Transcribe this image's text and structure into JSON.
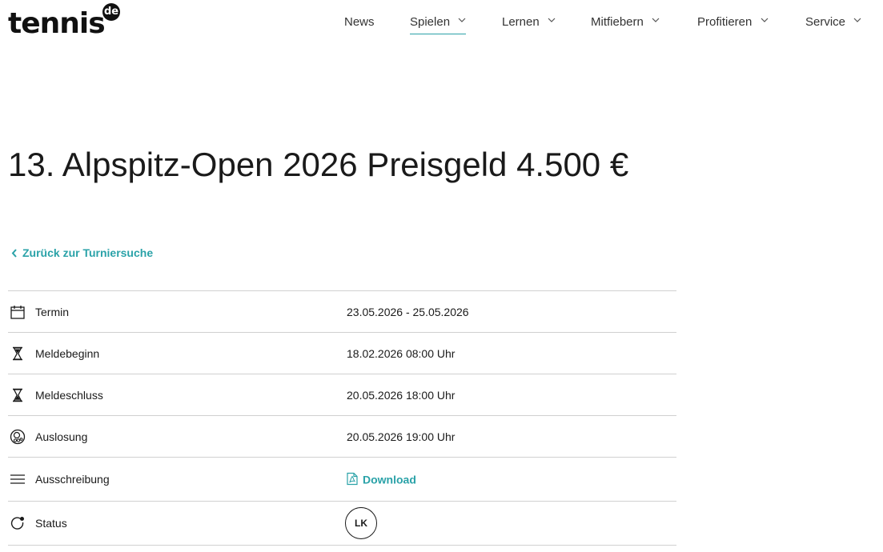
{
  "logo": {
    "text": "tennis",
    "badge": "de"
  },
  "nav": {
    "items": [
      {
        "label": "News",
        "has_dropdown": false,
        "active": false
      },
      {
        "label": "Spielen",
        "has_dropdown": true,
        "active": true
      },
      {
        "label": "Lernen",
        "has_dropdown": true,
        "active": false
      },
      {
        "label": "Mitfiebern",
        "has_dropdown": true,
        "active": false
      },
      {
        "label": "Profitieren",
        "has_dropdown": true,
        "active": false
      },
      {
        "label": "Service",
        "has_dropdown": true,
        "active": false
      }
    ]
  },
  "page": {
    "title": "13. Alpspitz-Open 2026 Preisgeld 4.500 €",
    "back_link": "Zurück zur Turniersuche"
  },
  "details": {
    "rows": [
      {
        "icon": "calendar-icon",
        "label": "Termin",
        "value": "23.05.2026 - 25.05.2026"
      },
      {
        "icon": "hourglass-start-icon",
        "label": "Meldebeginn",
        "value": "18.02.2026 08:00 Uhr"
      },
      {
        "icon": "hourglass-end-icon",
        "label": "Meldeschluss",
        "value": "20.05.2026 18:00 Uhr"
      },
      {
        "icon": "draw-icon",
        "label": "Auslosung",
        "value": "20.05.2026 19:00 Uhr"
      },
      {
        "icon": "menu-lines-icon",
        "label": "Ausschreibung",
        "value": "Download"
      },
      {
        "icon": "status-icon",
        "label": "Status",
        "value": "LK"
      }
    ]
  },
  "colors": {
    "accent": "#2aa2a8",
    "text": "#1a1a1a",
    "divider": "#d0d0d0"
  }
}
